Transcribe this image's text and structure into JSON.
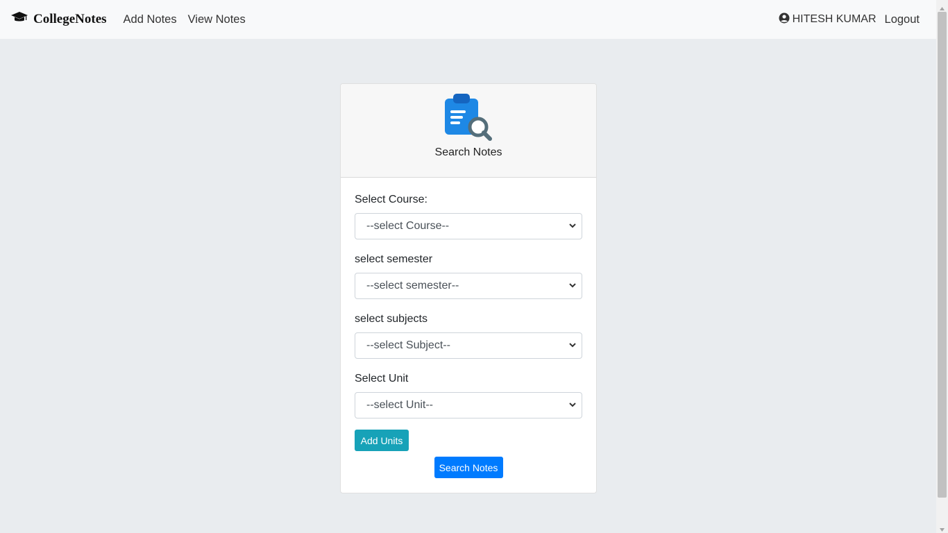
{
  "navbar": {
    "brand": "CollegeNotes",
    "brand_icon": "graduation-cap-icon",
    "links": [
      "Add Notes",
      "View Notes"
    ],
    "user_icon": "user-circle-icon",
    "user_name": "HITESH KUMAR",
    "logout": "Logout"
  },
  "card": {
    "icon": "search-notes-icon",
    "title": "Search Notes",
    "fields": [
      {
        "label": "Select Course:",
        "value": "--select Course--"
      },
      {
        "label": "select semester",
        "value": "--select semester--"
      },
      {
        "label": "select subjects",
        "value": "--select Subject--"
      },
      {
        "label": "Select Unit",
        "value": "--select Unit--"
      }
    ],
    "add_units_button": "Add Units",
    "search_button": "Search Notes"
  },
  "colors": {
    "info": "#17a2b8",
    "primary": "#007bff",
    "navbar_bg": "#f8f9fa",
    "page_bg": "#e9ecef"
  }
}
